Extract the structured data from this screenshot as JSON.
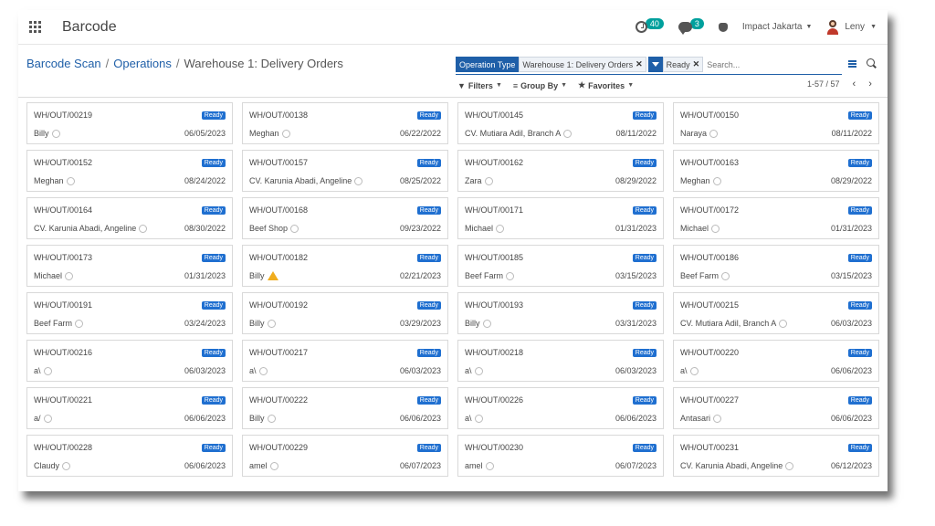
{
  "app": {
    "title": "Barcode"
  },
  "topbar": {
    "activity_count": "40",
    "messages_count": "3",
    "company": "Impact Jakarta",
    "user": "Leny"
  },
  "breadcrumb": {
    "item1": "Barcode Scan",
    "item2": "Operations",
    "current": "Warehouse 1: Delivery Orders"
  },
  "search": {
    "facet1_key": "Operation Type",
    "facet1_value": "Warehouse 1: Delivery Orders",
    "facet2_value": "Ready",
    "placeholder": "Search..."
  },
  "options": {
    "filters": "Filters",
    "group_by": "Group By",
    "favorites": "Favorites"
  },
  "pager": {
    "range": "1-57 / 57"
  },
  "cards": [
    {
      "ref": "WH/OUT/00219",
      "state": "Ready",
      "partner": "Billy",
      "date": "06/05/2023",
      "icon": "activity-circle"
    },
    {
      "ref": "WH/OUT/00138",
      "state": "Ready",
      "partner": "Meghan",
      "date": "06/22/2022",
      "icon": "activity-circle"
    },
    {
      "ref": "WH/OUT/00145",
      "state": "Ready",
      "partner": "CV. Mutiara Adil, Branch A",
      "date": "08/11/2022",
      "icon": "activity-circle"
    },
    {
      "ref": "WH/OUT/00150",
      "state": "Ready",
      "partner": "Naraya",
      "date": "08/11/2022",
      "icon": "activity-circle"
    },
    {
      "ref": "WH/OUT/00152",
      "state": "Ready",
      "partner": "Meghan",
      "date": "08/24/2022",
      "icon": "activity-circle"
    },
    {
      "ref": "WH/OUT/00157",
      "state": "Ready",
      "partner": "CV. Karunia Abadi, Angeline",
      "date": "08/25/2022",
      "icon": "activity-circle"
    },
    {
      "ref": "WH/OUT/00162",
      "state": "Ready",
      "partner": "Zara",
      "date": "08/29/2022",
      "icon": "activity-circle"
    },
    {
      "ref": "WH/OUT/00163",
      "state": "Ready",
      "partner": "Meghan",
      "date": "08/29/2022",
      "icon": "activity-circle"
    },
    {
      "ref": "WH/OUT/00164",
      "state": "Ready",
      "partner": "CV. Karunia Abadi, Angeline",
      "date": "08/30/2022",
      "icon": "activity-circle"
    },
    {
      "ref": "WH/OUT/00168",
      "state": "Ready",
      "partner": "Beef Shop",
      "date": "09/23/2022",
      "icon": "activity-circle"
    },
    {
      "ref": "WH/OUT/00171",
      "state": "Ready",
      "partner": "Michael",
      "date": "01/31/2023",
      "icon": "activity-circle"
    },
    {
      "ref": "WH/OUT/00172",
      "state": "Ready",
      "partner": "Michael",
      "date": "01/31/2023",
      "icon": "activity-circle"
    },
    {
      "ref": "WH/OUT/00173",
      "state": "Ready",
      "partner": "Michael",
      "date": "01/31/2023",
      "icon": "activity-circle"
    },
    {
      "ref": "WH/OUT/00182",
      "state": "Ready",
      "partner": "Billy",
      "date": "02/21/2023",
      "icon": "warning-icon"
    },
    {
      "ref": "WH/OUT/00185",
      "state": "Ready",
      "partner": "Beef Farm",
      "date": "03/15/2023",
      "icon": "activity-circle"
    },
    {
      "ref": "WH/OUT/00186",
      "state": "Ready",
      "partner": "Beef Farm",
      "date": "03/15/2023",
      "icon": "activity-circle"
    },
    {
      "ref": "WH/OUT/00191",
      "state": "Ready",
      "partner": "Beef Farm",
      "date": "03/24/2023",
      "icon": "activity-circle"
    },
    {
      "ref": "WH/OUT/00192",
      "state": "Ready",
      "partner": "Billy",
      "date": "03/29/2023",
      "icon": "activity-circle"
    },
    {
      "ref": "WH/OUT/00193",
      "state": "Ready",
      "partner": "Billy",
      "date": "03/31/2023",
      "icon": "activity-circle"
    },
    {
      "ref": "WH/OUT/00215",
      "state": "Ready",
      "partner": "CV. Mutiara Adil, Branch A",
      "date": "06/03/2023",
      "icon": "activity-circle"
    },
    {
      "ref": "WH/OUT/00216",
      "state": "Ready",
      "partner": "a\\",
      "date": "06/03/2023",
      "icon": "activity-circle"
    },
    {
      "ref": "WH/OUT/00217",
      "state": "Ready",
      "partner": "a\\",
      "date": "06/03/2023",
      "icon": "activity-circle"
    },
    {
      "ref": "WH/OUT/00218",
      "state": "Ready",
      "partner": "a\\",
      "date": "06/03/2023",
      "icon": "activity-circle"
    },
    {
      "ref": "WH/OUT/00220",
      "state": "Ready",
      "partner": "a\\",
      "date": "06/06/2023",
      "icon": "activity-circle"
    },
    {
      "ref": "WH/OUT/00221",
      "state": "Ready",
      "partner": "a/",
      "date": "06/06/2023",
      "icon": "activity-circle"
    },
    {
      "ref": "WH/OUT/00222",
      "state": "Ready",
      "partner": "Billy",
      "date": "06/06/2023",
      "icon": "activity-circle"
    },
    {
      "ref": "WH/OUT/00226",
      "state": "Ready",
      "partner": "a\\",
      "date": "06/06/2023",
      "icon": "activity-circle"
    },
    {
      "ref": "WH/OUT/00227",
      "state": "Ready",
      "partner": "Antasari",
      "date": "06/06/2023",
      "icon": "activity-circle"
    },
    {
      "ref": "WH/OUT/00228",
      "state": "Ready",
      "partner": "Claudy",
      "date": "06/06/2023",
      "icon": "activity-circle"
    },
    {
      "ref": "WH/OUT/00229",
      "state": "Ready",
      "partner": "amel",
      "date": "06/07/2023",
      "icon": "activity-circle"
    },
    {
      "ref": "WH/OUT/00230",
      "state": "Ready",
      "partner": "amel",
      "date": "06/07/2023",
      "icon": "activity-circle"
    },
    {
      "ref": "WH/OUT/00231",
      "state": "Ready",
      "partner": "CV. Karunia Abadi, Angeline",
      "date": "06/12/2023",
      "icon": "activity-circle"
    }
  ]
}
